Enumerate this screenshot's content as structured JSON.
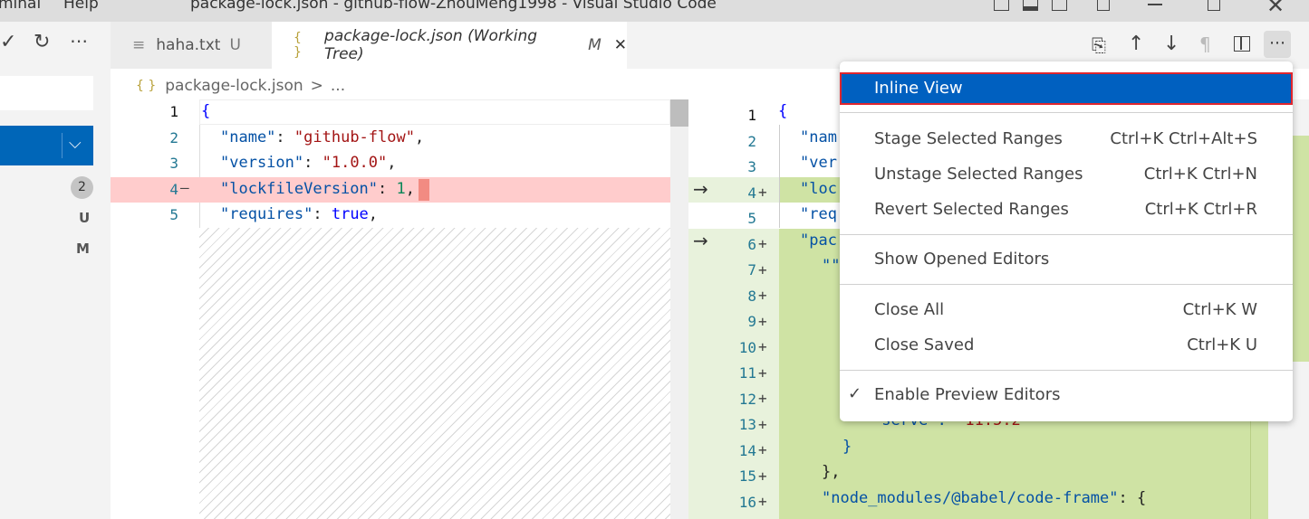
{
  "titlebar": {
    "menu": [
      "minal",
      "Help"
    ],
    "title": "package-lock.json - github-flow-ZhouMeng1998 - Visual Studio Code"
  },
  "sidebar": {
    "actions": [
      "check-icon",
      "refresh-icon",
      "more-icon"
    ],
    "badge_count": "2",
    "status_letters": [
      "U",
      "M"
    ]
  },
  "tabs": [
    {
      "label": "haha.txt",
      "status": "U",
      "icon": "text-file-icon"
    },
    {
      "label": "package-lock.json (Working Tree)",
      "status": "M",
      "icon": "json-icon",
      "active": true
    }
  ],
  "breadcrumb": {
    "file": "package-lock.json",
    "sep": ">",
    "rest": "..."
  },
  "editor_actions": [
    "open-file-icon",
    "arrow-up-icon",
    "arrow-down-icon",
    "pilcrow-icon",
    "split-editor-icon",
    "more-actions-icon"
  ],
  "left_lines": {
    "n1": "1",
    "n2": "2",
    "n3": "3",
    "n4": "4",
    "n5": "5",
    "l1": "{",
    "l2k": "\"name\"",
    "l2v": "\"github-flow\"",
    "l3k": "\"version\"",
    "l3v": "\"1.0.0\"",
    "l4k": "\"lockfileVersion\"",
    "l4v": "1",
    "l5k": "\"requires\"",
    "l5v": "true"
  },
  "right_lines": {
    "nums": [
      "1",
      "2",
      "3",
      "4",
      "5",
      "6",
      "7",
      "8",
      "9",
      "10",
      "11",
      "12",
      "13",
      "14",
      "15",
      "16"
    ],
    "t1": "{",
    "t2": "\"nam",
    "t3": "\"ver",
    "t4": "\"loc",
    "t5": "\"req",
    "t6": "\"pac",
    "t7": "\"\"",
    "t13k": "\"serve\":",
    "t13v": "\"11.5.2\"",
    "t14": "}",
    "t15": "},",
    "t16k": "\"node_modules/@babel/code-frame\"",
    "t16r": ": {"
  },
  "context_menu": {
    "items": [
      {
        "label": "Inline View",
        "shortcut": "",
        "active": true
      },
      {
        "label": "Stage Selected Ranges",
        "shortcut": "Ctrl+K Ctrl+Alt+S"
      },
      {
        "label": "Unstage Selected Ranges",
        "shortcut": "Ctrl+K Ctrl+N"
      },
      {
        "label": "Revert Selected Ranges",
        "shortcut": "Ctrl+K Ctrl+R"
      },
      {
        "label": "Show Opened Editors",
        "shortcut": ""
      },
      {
        "label": "Close All",
        "shortcut": "Ctrl+K W"
      },
      {
        "label": "Close Saved",
        "shortcut": "Ctrl+K U"
      },
      {
        "label": "Enable Preview Editors",
        "shortcut": "",
        "checked": true
      }
    ]
  },
  "colors": {
    "accent": "#0060c0",
    "highlight_border": "#e0262e",
    "deleted": "#ffcccc",
    "inserted": "#cfe3a4"
  }
}
